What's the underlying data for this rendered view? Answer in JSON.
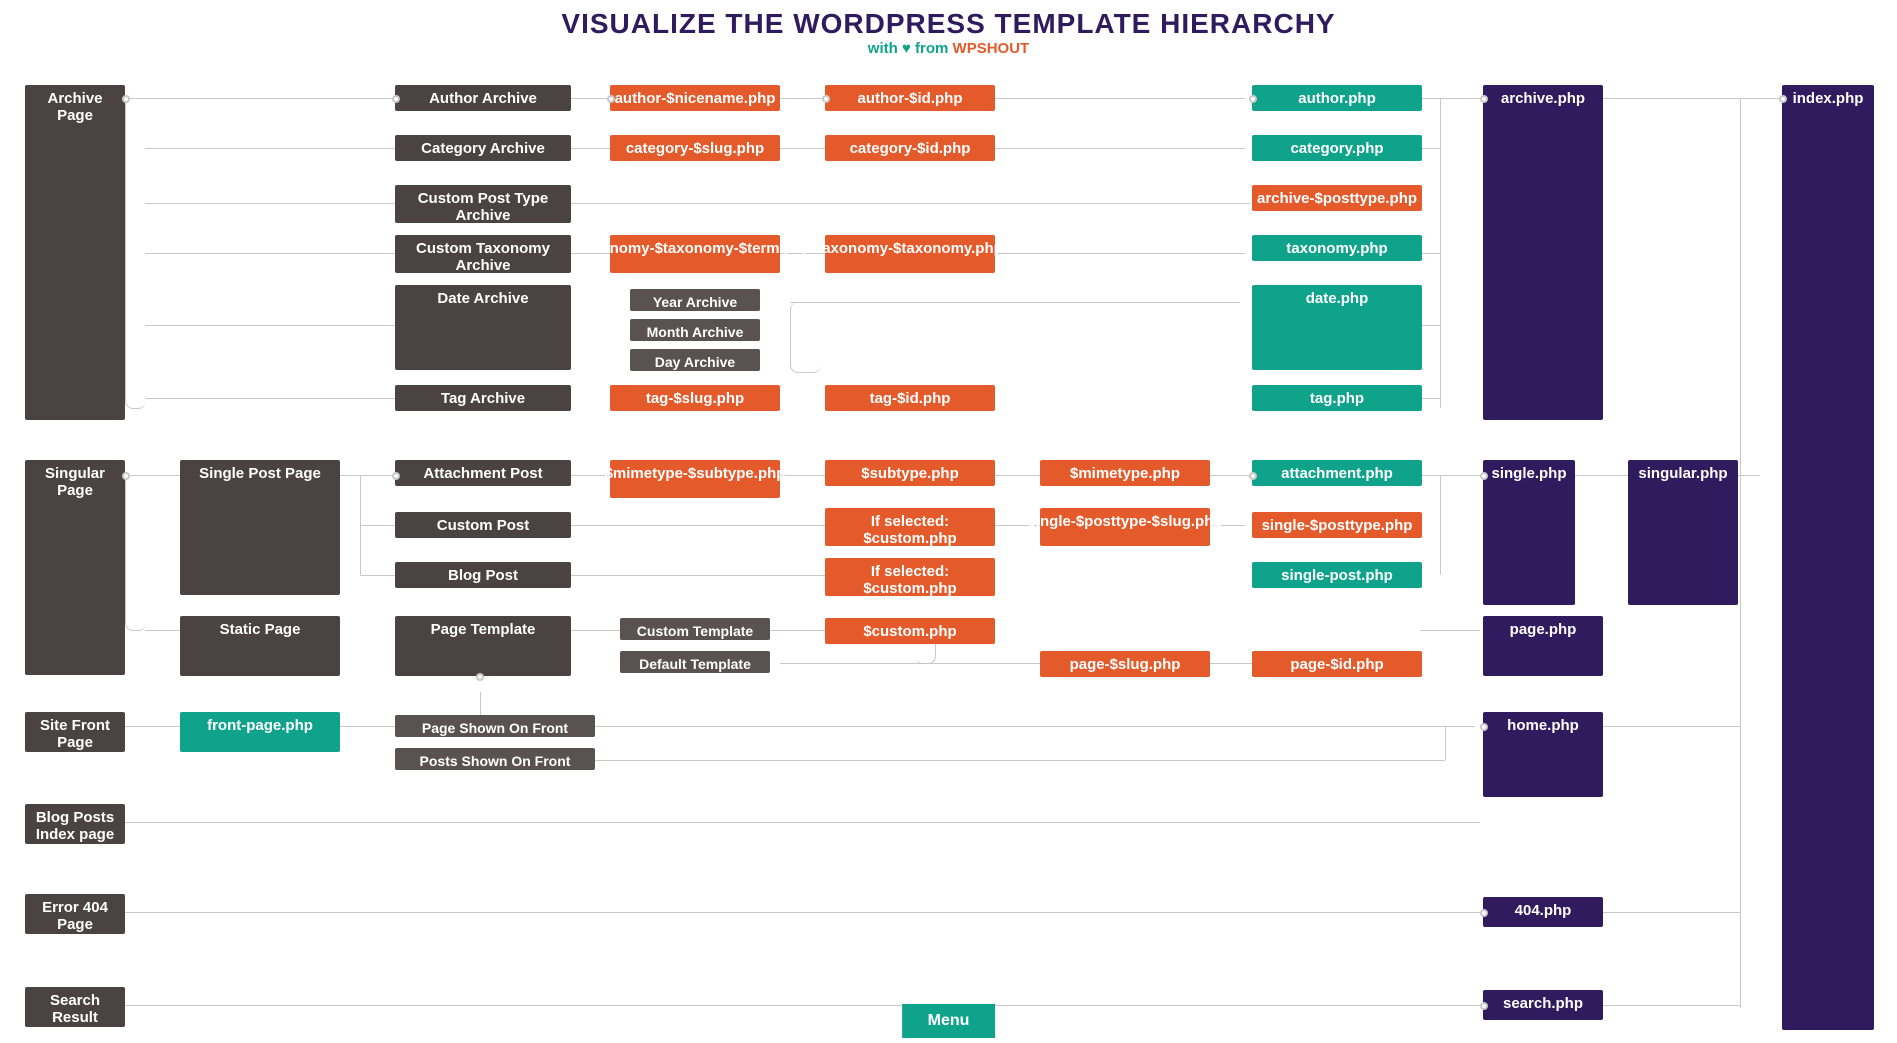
{
  "header": {
    "title": "VISUALIZE THE WORDPRESS TEMPLATE HIERARCHY",
    "subtitle_prefix": "with ♥ from ",
    "subtitle_brand": "WPSHOUT"
  },
  "menu_label": "Menu",
  "colors": {
    "gray": "#4b4343",
    "gray_light": "#5a5251",
    "orange": "#e45a2a",
    "teal": "#0fa38b",
    "purple": "#2f1b5e"
  },
  "nodes": {
    "archive_page": "Archive Page",
    "author_archive": "Author Archive",
    "author_nicename": "author-$nicename.php",
    "author_id": "author-$id.php",
    "author_php": "author.php",
    "category_archive": "Category Archive",
    "category_slug": "category-$slug.php",
    "category_id": "category-$id.php",
    "category_php": "category.php",
    "cpt_archive": "Custom Post Type Archive",
    "archive_posttype": "archive-$posttype.php",
    "custom_tax_archive": "Custom Taxonomy Archive",
    "taxonomy_term": "taxonomy-$taxonomy-$term.php",
    "taxonomy_tax": "taxonomy-$taxonomy.php",
    "taxonomy_php": "taxonomy.php",
    "date_archive": "Date Archive",
    "year_archive": "Year Archive",
    "month_archive": "Month Archive",
    "day_archive": "Day Archive",
    "date_php": "date.php",
    "tag_archive": "Tag Archive",
    "tag_slug": "tag-$slug.php",
    "tag_id": "tag-$id.php",
    "tag_php": "tag.php",
    "archive_php": "archive.php",
    "index_php": "index.php",
    "singular_page": "Singular Page",
    "single_post_page": "Single Post Page",
    "attachment_post": "Attachment Post",
    "mimetype_subtype": "$mimetype-$subtype.php",
    "subtype_php": "$subtype.php",
    "mimetype_php": "$mimetype.php",
    "attachment_php": "attachment.php",
    "custom_post": "Custom Post",
    "if_selected_custom_1": "If selected: $custom.php",
    "single_posttype_slug": "single-$posttype-$slug.php",
    "single_posttype": "single-$posttype.php",
    "blog_post": "Blog Post",
    "if_selected_custom_2": "If selected: $custom.php",
    "single_post_php": "single-post.php",
    "single_php": "single.php",
    "singular_php": "singular.php",
    "static_page": "Static Page",
    "page_template": "Page Template",
    "custom_template": "Custom Template",
    "custom_php": "$custom.php",
    "default_template": "Default Template",
    "page_slug": "page-$slug.php",
    "page_id": "page-$id.php",
    "page_php": "page.php",
    "site_front_page": "Site Front Page",
    "front_page_php": "front-page.php",
    "page_shown_on_front": "Page Shown On Front",
    "posts_shown_on_front": "Posts Shown On Front",
    "home_php": "home.php",
    "blog_posts_index": "Blog Posts Index page",
    "error_404": "Error 404 Page",
    "404_php": "404.php",
    "search_result": "Search Result Page",
    "search_php": "search.php"
  }
}
